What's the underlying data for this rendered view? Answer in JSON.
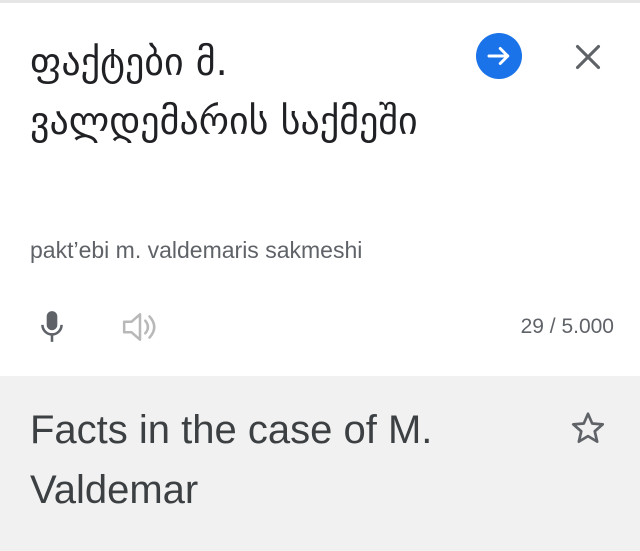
{
  "source": {
    "text": "ფაქტები მ. ვალდემარის საქმეში",
    "transliteration": "pakt’ebi m. valdemaris sakmeshi",
    "char_count": "29 / 5.000",
    "icons": {
      "go": "arrow-right-icon",
      "close": "close-icon",
      "mic": "microphone-icon",
      "speaker": "speaker-icon"
    }
  },
  "result": {
    "text": "Facts in the case of M. Valdemar",
    "icons": {
      "star": "star-icon"
    }
  },
  "colors": {
    "accent": "#1a73e8",
    "result_background": "#f1f1f1",
    "primary_text": "#202124",
    "secondary_text": "#5f6368"
  }
}
